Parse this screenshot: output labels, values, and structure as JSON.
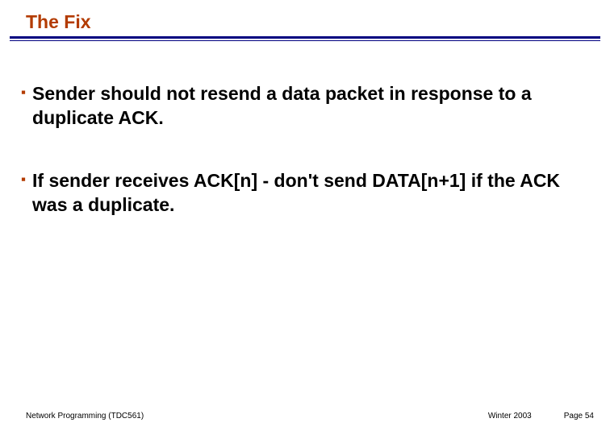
{
  "title": "The Fix",
  "bullets": [
    "Sender should not resend a data packet in response to a duplicate ACK.",
    "If sender receives ACK[n] - don't send DATA[n+1] if the ACK was a duplicate."
  ],
  "footer": {
    "left": "Network Programming (TDC561)",
    "term": "Winter  2003",
    "page": "Page 54"
  }
}
